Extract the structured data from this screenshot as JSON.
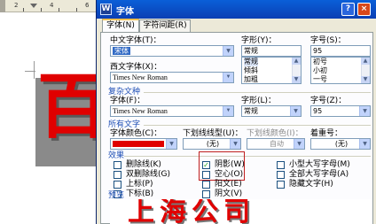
{
  "document": {
    "ruler_numbers": [
      "2",
      "4",
      "6"
    ],
    "preview_char": "百"
  },
  "dialog": {
    "title": "字体",
    "help_label": "?",
    "close_label": "×",
    "tabs": [
      {
        "label": "字体(N)",
        "active": true
      },
      {
        "label": "字符间距(R)",
        "active": false
      }
    ],
    "chinese_font": {
      "label": "中文字体(T)：",
      "value": "宋体"
    },
    "western_font": {
      "label": "西文字体(X)：",
      "value": "Times New Roman"
    },
    "font_style": {
      "label": "字形(Y)：",
      "value": "常规",
      "options": [
        "常规",
        "倾斜",
        "加粗"
      ]
    },
    "font_size": {
      "label": "字号(S)：",
      "value": "95",
      "options": [
        "初号",
        "小初",
        "一号"
      ]
    },
    "complex_script": {
      "section_label": "复杂文种",
      "font_label": "字体(F)：",
      "font_value": "Times New Roman",
      "style_label": "字形(L)：",
      "style_value": "常规",
      "size_label": "字号(Z)：",
      "size_value": "95"
    },
    "all_text": {
      "section_label": "所有文字",
      "font_color_label": "字体颜色(C)：",
      "font_color": "#e00000",
      "underline_style_label": "下划线线型(U)：",
      "underline_style_value": "(无)",
      "underline_color_label": "下划线颜色(I)：",
      "underline_color_value": "自动",
      "emphasis_label": "着重号：",
      "emphasis_value": "(无)"
    },
    "effects": {
      "section_label": "效果",
      "col1": [
        {
          "label": "删除线(K)",
          "checked": false
        },
        {
          "label": "双删除线(G)",
          "checked": false
        },
        {
          "label": "上标(P)",
          "checked": false
        },
        {
          "label": "下标(B)",
          "checked": false
        }
      ],
      "col2": [
        {
          "label": "阴影(W)",
          "checked": true
        },
        {
          "label": "空心(O)",
          "checked": false
        },
        {
          "label": "阳文(E)",
          "checked": false
        },
        {
          "label": "阴文(V)",
          "checked": false
        }
      ],
      "col3": [
        {
          "label": "小型大写字母(M)",
          "checked": false
        },
        {
          "label": "全部大写字母(A)",
          "checked": false
        },
        {
          "label": "隐藏文字(H)",
          "checked": false
        }
      ]
    },
    "preview": {
      "section_label": "预览",
      "text": "上海公司"
    }
  },
  "colors": {
    "title_bar": "#0b3fb3",
    "dialog_bg": "#ece9d8",
    "text_red": "#e00000",
    "highlight_red": "#c02020"
  }
}
